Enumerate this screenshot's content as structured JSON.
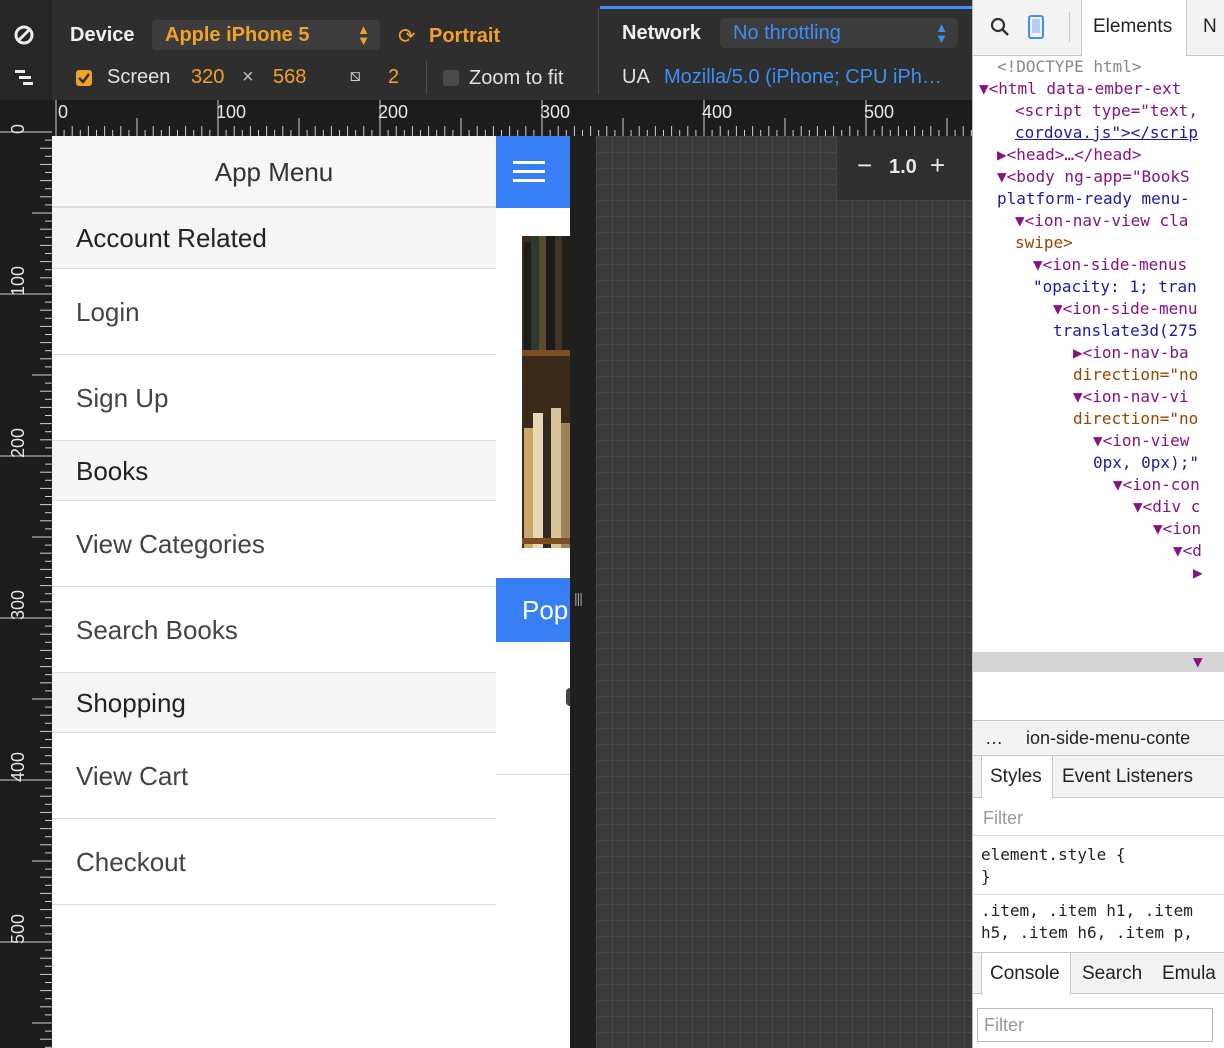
{
  "toolbar": {
    "device_label": "Device",
    "device_value": "Apple iPhone 5",
    "orientation_label": "Portrait",
    "screen_label": "Screen",
    "screen_width": "320",
    "screen_times": "×",
    "screen_height": "568",
    "pixel_ratio": "2",
    "zoom_to_fit_label": "Zoom to fit",
    "network_label": "Network",
    "network_value": "No throttling",
    "ua_label": "UA",
    "ua_value": "Mozilla/5.0 (iPhone; CPU iPh…",
    "accent_orange": "#f3a02a",
    "accent_blue": "#3d8ef5"
  },
  "rulers": {
    "top_numbers": [
      "0",
      "100",
      "200",
      "300",
      "400",
      "500"
    ],
    "left_numbers": [
      "0",
      "100",
      "200",
      "300",
      "400",
      "500"
    ]
  },
  "app": {
    "menu_title": "App Menu",
    "items": [
      {
        "label": "Account Related",
        "divider": true
      },
      {
        "label": "Login",
        "divider": false
      },
      {
        "label": "Sign Up",
        "divider": false
      },
      {
        "label": "Books",
        "divider": true
      },
      {
        "label": "View Categories",
        "divider": false
      },
      {
        "label": "Search Books",
        "divider": false
      },
      {
        "label": "Shopping",
        "divider": true
      },
      {
        "label": "View Cart",
        "divider": false
      },
      {
        "label": "Checkout",
        "divider": false
      }
    ],
    "popular_button": "Pop",
    "brand_color": "#387ef5"
  },
  "zoom": {
    "minus": "−",
    "value": "1.0",
    "plus": "+"
  },
  "devtools": {
    "tabs": {
      "elements": "Elements",
      "next": "N"
    },
    "dom_lines": [
      "<!DOCTYPE html>",
      "▼<html data-ember-ext",
      "<script type=\"text,",
      "cordova.js\"></scrip",
      "▶<head>…</head>",
      "▼<body ng-app=\"BookS",
      "platform-ready menu-",
      "▼<ion-nav-view cla",
      "swipe>",
      "▼<ion-side-menus",
      "\"opacity: 1; tran",
      "▼<ion-side-menu",
      "translate3d(275",
      "▶<ion-nav-ba",
      "direction=\"no",
      "▼<ion-nav-vi",
      "direction=\"no",
      "▼<ion-view",
      "0px, 0px);\"",
      "▼<ion-con",
      "▼<div c",
      "▼<ion",
      "▼<d",
      "▶"
    ],
    "selected_line": "▼",
    "breadcrumb_dots": "…",
    "breadcrumb": "ion-side-menu-conte",
    "styles_tab": "Styles",
    "event_listeners_tab": "Event Listeners",
    "filter_placeholder": "Filter",
    "element_style": "element.style {",
    "close_brace": "}",
    "rule_line1": ".item, .item h1, .item",
    "rule_line2": "h5, .item h6, .item p,",
    "console_tab": "Console",
    "search_tab": "Search",
    "emulation_tab": "Emula",
    "console_filter_placeholder": "Filter"
  }
}
